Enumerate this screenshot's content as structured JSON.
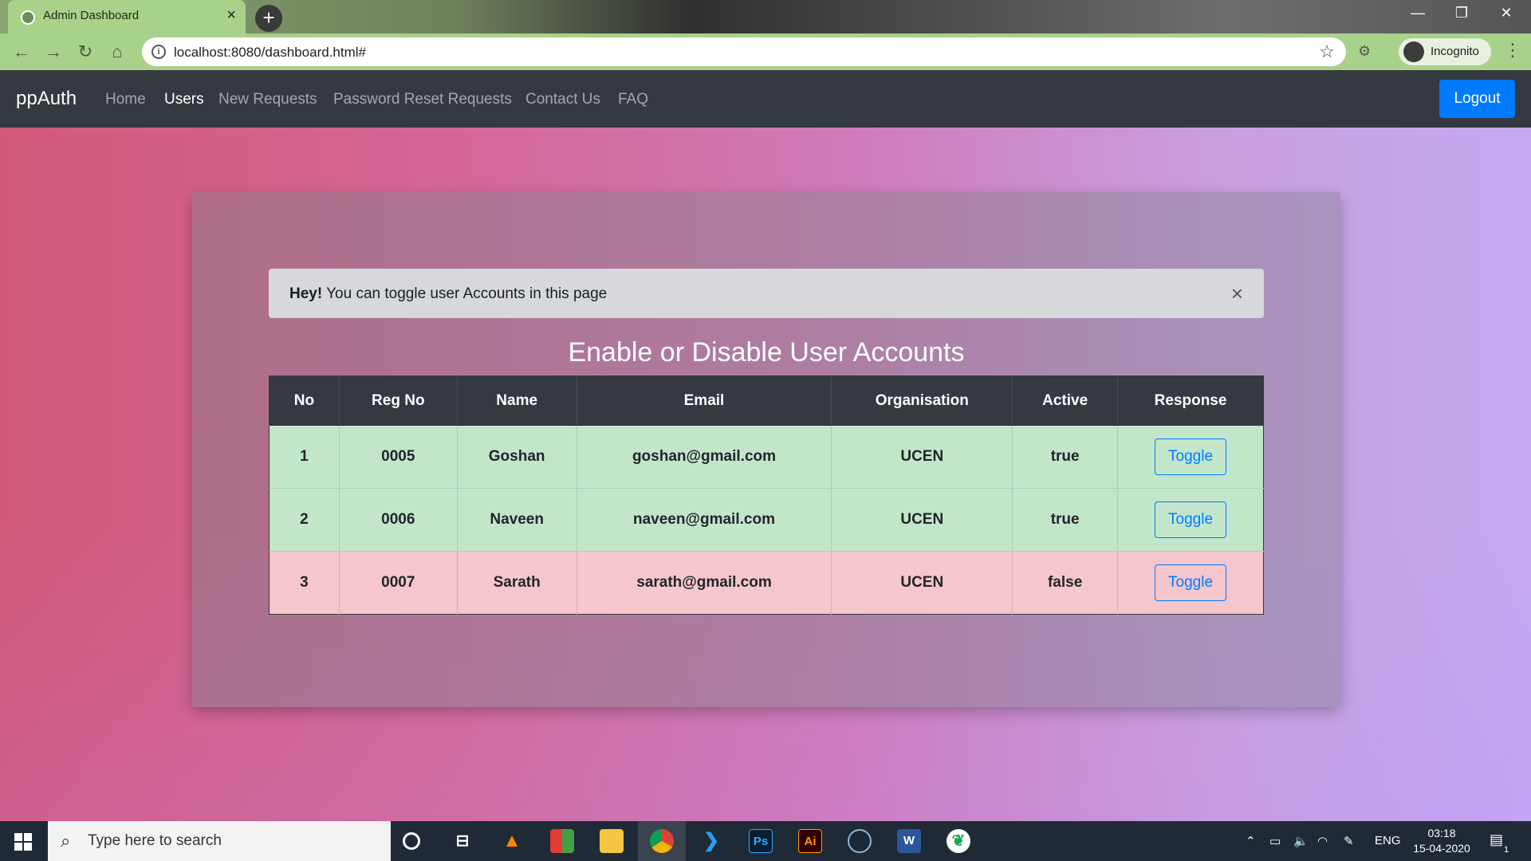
{
  "browser": {
    "tab_title": "Admin Dashboard",
    "tab_close": "×",
    "new_tab": "+",
    "url": "localhost:8080/dashboard.html#",
    "incognito_label": "Incognito",
    "window_controls": {
      "minimize": "—",
      "restore": "❐",
      "close": "✕"
    }
  },
  "navbar": {
    "brand": "ppAuth",
    "links": [
      "Home",
      "Users",
      "New Requests",
      "Password Reset Requests",
      "Contact Us",
      "FAQ"
    ],
    "active_link": "Users",
    "logout_label": "Logout"
  },
  "alert": {
    "strong": "Hey!",
    "text": " You can toggle user Accounts in this page",
    "close": "×"
  },
  "heading": "Enable or Disable User Accounts",
  "table": {
    "headers": [
      "No",
      "Reg No",
      "Name",
      "Email",
      "Organisation",
      "Active",
      "Response"
    ],
    "rows": [
      {
        "no": "1",
        "reg_no": "0005",
        "name": "Goshan",
        "email": "goshan@gmail.com",
        "organisation": "UCEN",
        "active": "true",
        "response": "Toggle",
        "status": "success"
      },
      {
        "no": "2",
        "reg_no": "0006",
        "name": "Naveen",
        "email": "naveen@gmail.com",
        "organisation": "UCEN",
        "active": "true",
        "response": "Toggle",
        "status": "success"
      },
      {
        "no": "3",
        "reg_no": "0007",
        "name": "Sarath",
        "email": "sarath@gmail.com",
        "organisation": "UCEN",
        "active": "false",
        "response": "Toggle",
        "status": "danger"
      }
    ]
  },
  "taskbar": {
    "search_placeholder": "Type here to search",
    "apps": [
      "cortana-icon",
      "task-view-icon",
      "vlc-icon",
      "tiles-icon",
      "file-explorer-icon",
      "chrome-icon",
      "vscode-icon",
      "photoshop-icon",
      "illustrator-icon",
      "steam-icon",
      "word-icon",
      "mongodb-icon"
    ],
    "photoshop_label": "Ps",
    "illustrator_label": "Ai",
    "word_label": "W",
    "language": "ENG",
    "time": "03:18",
    "date": "15-04-2020",
    "notifications": "1"
  },
  "colors": {
    "navbar_bg": "#343a40",
    "primary": "#007bff",
    "success_row": "#c3e6cb",
    "danger_row": "#f5c6cb",
    "chrome_tab": "#a8d18a"
  }
}
